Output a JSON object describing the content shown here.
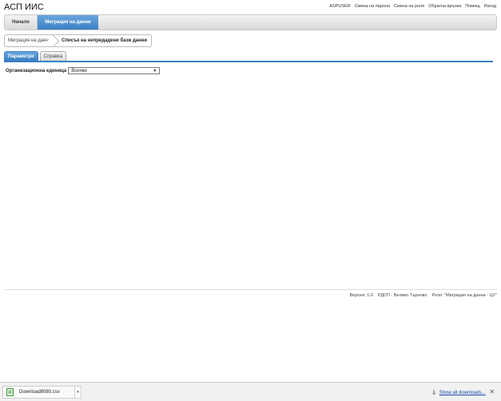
{
  "app": {
    "title": "АСП ИИС"
  },
  "top_links": [
    "ASPUSER",
    "Смяна на парола",
    "Смяна на роля",
    "Обратна връзка",
    "Помощ",
    "Изход"
  ],
  "nav": {
    "home": "Начало",
    "active": "Миграция на данни"
  },
  "breadcrumb": {
    "parent": "Миграция на данни",
    "current": "Списък на непредадени бази данни"
  },
  "tabs": {
    "params": "Параметри",
    "help": "Справка"
  },
  "form": {
    "org_label": "Организационна единица",
    "org_value": "Всички"
  },
  "footer": {
    "version": "Версия: 1.0",
    "office": "РДСП - Велико Търново",
    "role": "Роля: \"Миграция на данни - ЦУ\""
  },
  "downloads": {
    "file_name": "Download8080.csv",
    "file_icon": "csv-file-icon",
    "show_all": "Show all downloads..."
  },
  "colors": {
    "accent": "#3a7fc3",
    "link": "#1a4aa8"
  }
}
